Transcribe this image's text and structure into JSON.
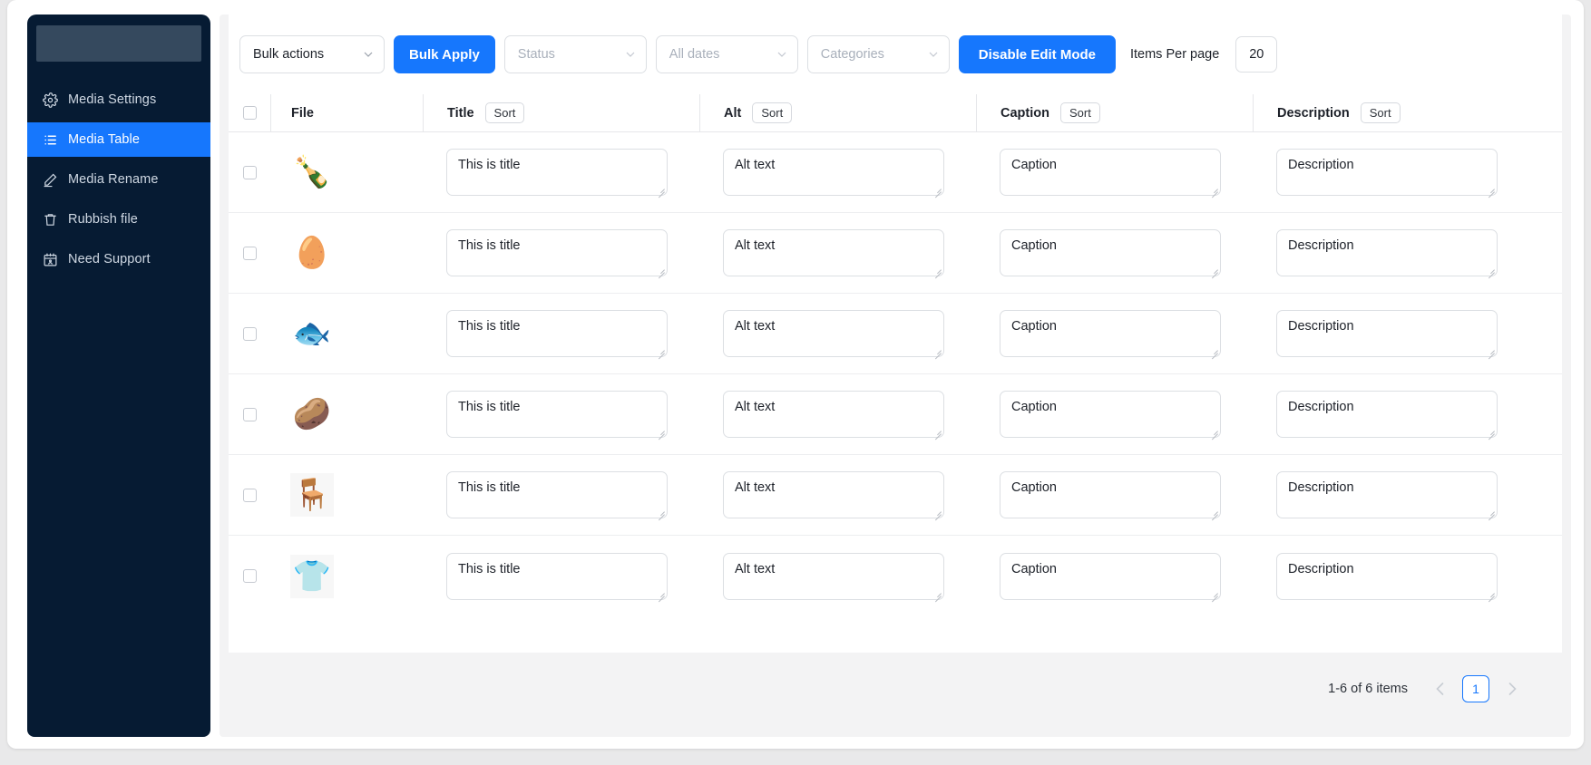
{
  "sidebar": {
    "brand_block": "",
    "items": [
      {
        "label": "Media Settings",
        "icon": "gear-icon",
        "active": false
      },
      {
        "label": "Media Table",
        "icon": "list-icon",
        "active": true
      },
      {
        "label": "Media Rename",
        "icon": "pencil-icon",
        "active": false
      },
      {
        "label": "Rubbish file",
        "icon": "trash-icon",
        "active": false
      },
      {
        "label": "Need Support",
        "icon": "calendar-icon",
        "active": false
      }
    ]
  },
  "toolbar": {
    "bulk_actions_value": "Bulk actions",
    "bulk_apply_label": "Bulk Apply",
    "status_placeholder": "Status",
    "dates_placeholder": "All dates",
    "categories_placeholder": "Categories",
    "edit_mode_label": "Disable Edit Mode",
    "items_per_page_label": "Items Per page",
    "items_per_page_value": "20"
  },
  "table": {
    "headers": {
      "file": "File",
      "title": "Title",
      "alt": "Alt",
      "caption": "Caption",
      "description": "Description",
      "sort_label": "Sort"
    },
    "rows": [
      {
        "thumb": "🍾",
        "thumb_name": "oil-bottle-thumbnail",
        "boxed": false,
        "title": "This is title",
        "alt": "Alt text",
        "caption": "Caption",
        "description": "Description"
      },
      {
        "thumb": "🥚",
        "thumb_name": "eggs-thumbnail",
        "boxed": false,
        "title": "This is title",
        "alt": "Alt text",
        "caption": "Caption",
        "description": "Description"
      },
      {
        "thumb": "🐟",
        "thumb_name": "fish-thumbnail",
        "boxed": false,
        "title": "This is title",
        "alt": "Alt text",
        "caption": "Caption",
        "description": "Description"
      },
      {
        "thumb": "🥔",
        "thumb_name": "potatoes-thumbnail",
        "boxed": false,
        "title": "This is title",
        "alt": "Alt text",
        "caption": "Caption",
        "description": "Description"
      },
      {
        "thumb": "🪑",
        "thumb_name": "chair-thumbnail",
        "boxed": true,
        "title": "This is title",
        "alt": "Alt text",
        "caption": "Caption",
        "description": "Description"
      },
      {
        "thumb": "👕",
        "thumb_name": "shirt-thumbnail",
        "boxed": true,
        "title": "This is title",
        "alt": "Alt text",
        "caption": "Caption",
        "description": "Description"
      }
    ]
  },
  "footer": {
    "count_text": "1-6 of 6 items",
    "page_number": "1"
  },
  "colors": {
    "accent": "#1677fd",
    "sidebar_bg": "#061B33",
    "panel_bg": "#f3f3f4",
    "page_bg": "#e9e9ea"
  }
}
